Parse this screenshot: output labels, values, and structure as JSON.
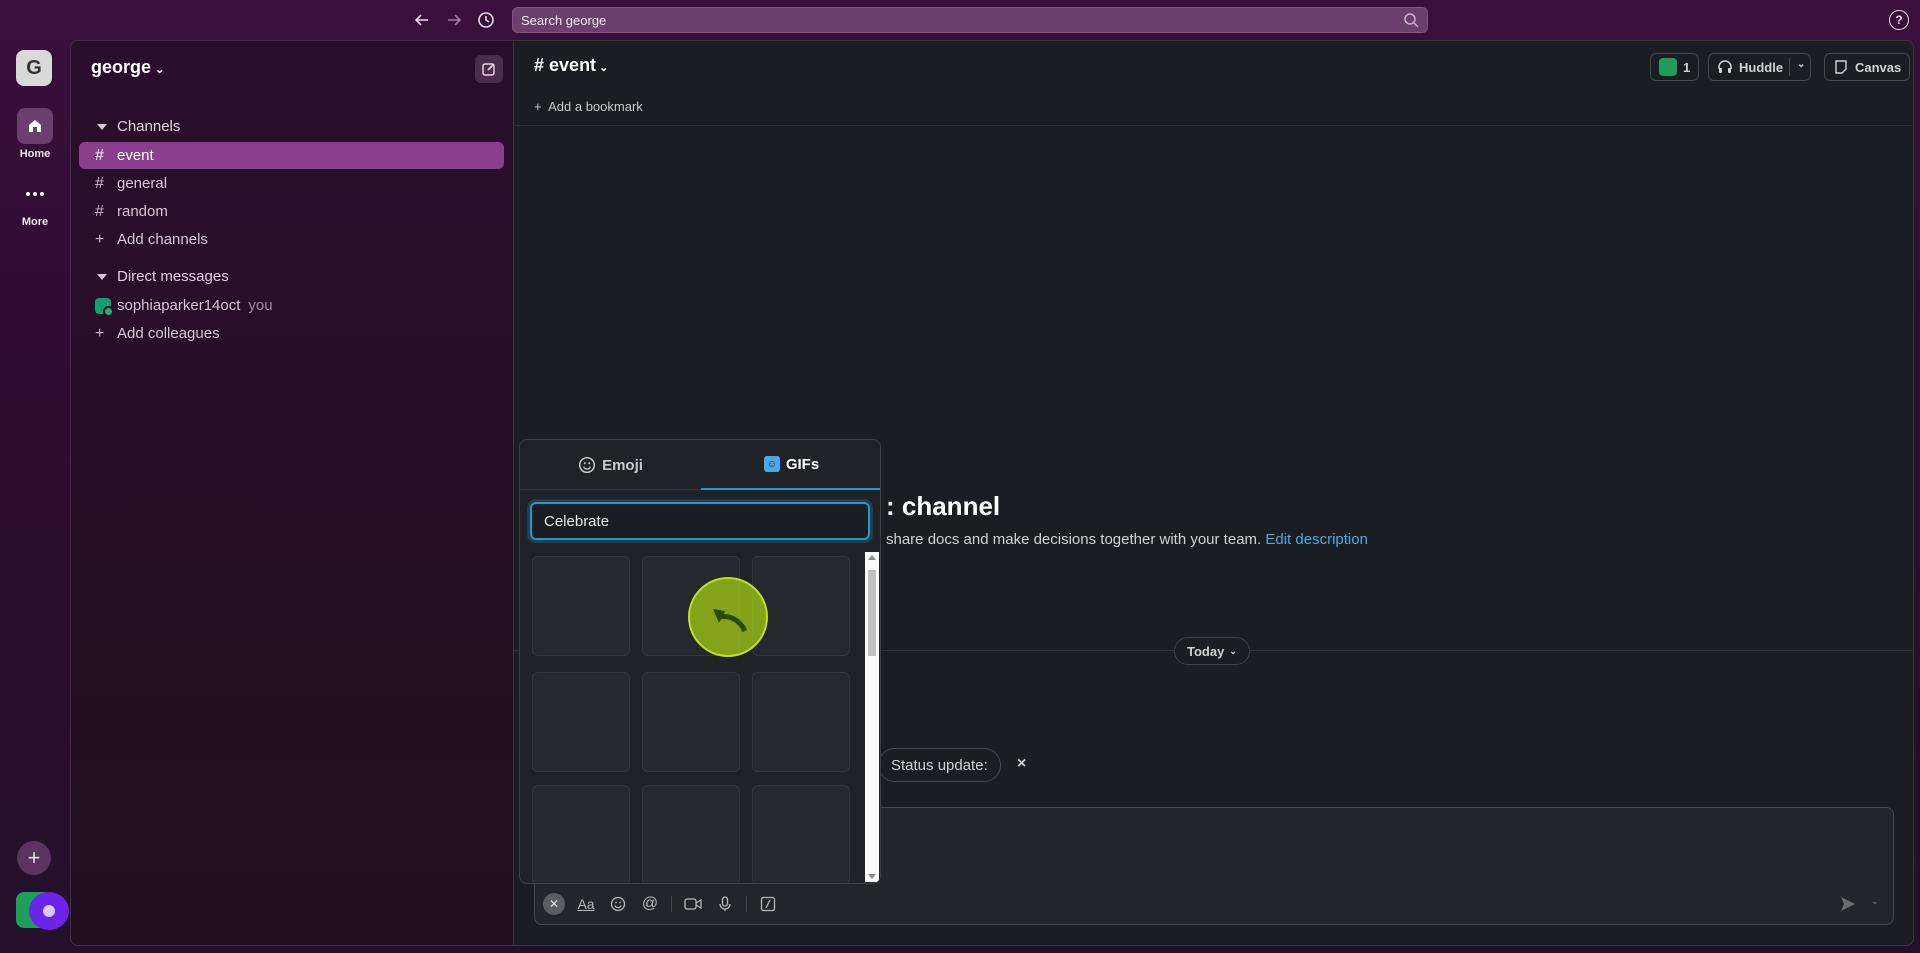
{
  "topbar": {
    "search_placeholder": "Search george",
    "help_label": "?"
  },
  "rail": {
    "workspace_initial": "G",
    "home_label": "Home",
    "more_label": "More",
    "add_label": "+"
  },
  "sidebar": {
    "workspace_name": "george",
    "channels_header": "Channels",
    "channels": [
      {
        "name": "event",
        "active": true
      },
      {
        "name": "general",
        "active": false
      },
      {
        "name": "random",
        "active": false
      }
    ],
    "add_channels": "Add channels",
    "dm_header": "Direct messages",
    "dm_user": "sophiaparker14oct",
    "dm_you": "you",
    "add_colleagues": "Add colleagues"
  },
  "channel": {
    "title": "event",
    "add_bookmark": "Add a bookmark",
    "members_count": "1",
    "huddle_label": "Huddle",
    "canvas_label": "Canvas",
    "intro_title_fragment": ": channel",
    "intro_desc": "share docs and make decisions together with your team.",
    "edit_description": "Edit description",
    "today_label": "Today",
    "status_update": "Status update:",
    "status_close": "×"
  },
  "picker": {
    "tab_emoji": "Emoji",
    "tab_gifs": "GIFs",
    "search_value": "Celebrate"
  },
  "composer": {
    "tool_format": "Aa"
  }
}
